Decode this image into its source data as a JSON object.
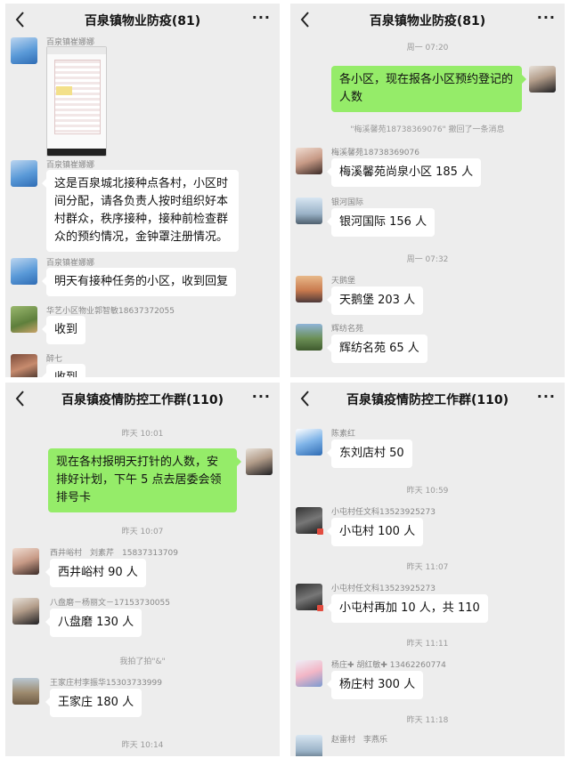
{
  "panels": [
    {
      "title": "百泉镇物业防疫(81)",
      "messages": [
        {
          "name": "百泉镇崔娜娜"
        },
        {
          "name": "百泉镇崔娜娜",
          "text": "这是百泉城北接种点各村，小区时间分配，请各负责人按时组织好本村群众，秩序接种，接种前检查群众的预约情况，金钟罩注册情况。"
        },
        {
          "name": "百泉镇崔娜娜",
          "text": "明天有接种任务的小区，收到回复"
        },
        {
          "name": "华艺小区物业郭智敏18637372055",
          "text": "收到"
        },
        {
          "name": "醉七",
          "text": "收到"
        }
      ]
    },
    {
      "title": "百泉镇物业防疫(81)",
      "time1": "周一 07:20",
      "self_text": "各小区，现在报各小区预约登记的人数",
      "notice": "\"梅溪馨苑18738369076\" 撤回了一条消息",
      "time2": "周一 07:32",
      "messages": [
        {
          "name": "梅溪馨苑18738369076",
          "text": "梅溪馨苑尚泉小区 185 人"
        },
        {
          "name": "银河国际",
          "text": "银河国际 156 人"
        },
        {
          "name": "天鹅堡",
          "text": "天鹅堡 203 人"
        },
        {
          "name": "辉纺名苑",
          "text": "辉纺名苑 65 人"
        }
      ]
    },
    {
      "title": "百泉镇疫情防控工作群(110)",
      "time1": "昨天 10:01",
      "self_text": "现在各村报明天打针的人数，安排好计划，下午 5 点去居委会领排号卡",
      "time2": "昨天 10:07",
      "notice": "我拍了拍\"&\"",
      "time3": "昨天 10:14",
      "messages": [
        {
          "name": "西井峪村　刘素芹　15837313709",
          "text": "西井峪村 90 人"
        },
        {
          "name": "八盘磨－杨丽文－17153730055",
          "text": "八盘磨 130 人"
        },
        {
          "name": "王家庄村李振华15303733999",
          "text": "王家庄 180 人"
        }
      ]
    },
    {
      "title": "百泉镇疫情防控工作群(110)",
      "times": [
        "昨天 10:59",
        "昨天 11:07",
        "昨天 11:11",
        "昨天 11:18"
      ],
      "messages": [
        {
          "name": "陈素红",
          "text": "东刘店村 50"
        },
        {
          "name": "小屯村任文科13523925273",
          "text": "小屯村 100 人"
        },
        {
          "name": "小屯村任文科13523925273",
          "text": "小屯村再加 10 人，共 110"
        },
        {
          "name": "杨庄✚ 胡红敏✚ 13462260774",
          "text": "杨庄村 300 人"
        },
        {
          "name": "赵雷村　李燕乐"
        }
      ]
    }
  ],
  "icons": {
    "back": "chevron-left-icon",
    "more": "more-dots-icon"
  },
  "colors": {
    "self_bubble": "#95ec69",
    "background": "#ededed"
  }
}
